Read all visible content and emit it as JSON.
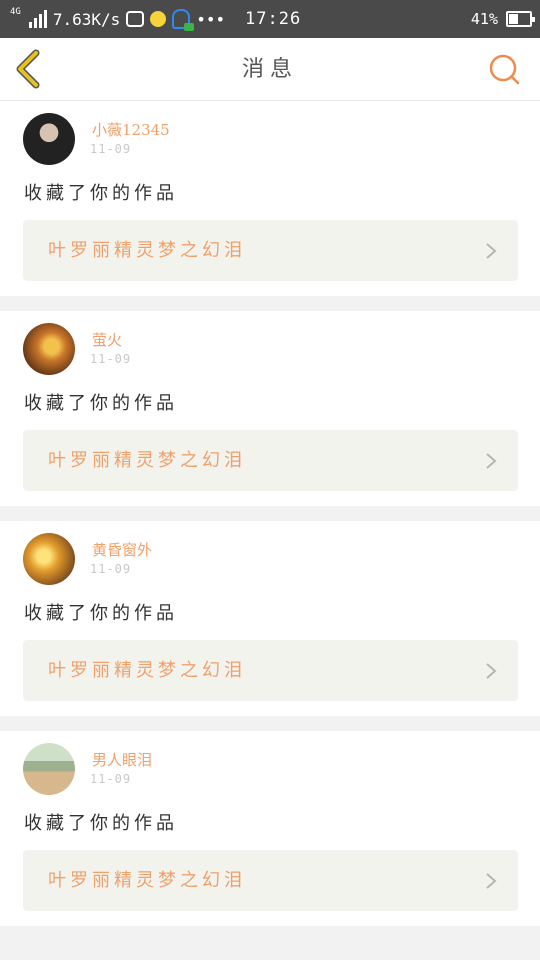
{
  "status_bar": {
    "network": "4G",
    "speed": "7.63K/s",
    "time": "17:26",
    "battery": "41%"
  },
  "header": {
    "title": "消息",
    "back_icon": "chevron-left-icon",
    "search_icon": "search-icon"
  },
  "colors": {
    "accent": "#f0a06a",
    "back_icon": "#e8c21c",
    "search_icon": "#f08a4b",
    "card_link_bg": "#f3f3ee"
  },
  "messages": [
    {
      "username": "小薇12345",
      "date": "11-09",
      "action": "收藏了你的作品",
      "work_title": "叶罗丽精灵梦之幻泪"
    },
    {
      "username": "萤火",
      "date": "11-09",
      "action": "收藏了你的作品",
      "work_title": "叶罗丽精灵梦之幻泪"
    },
    {
      "username": "黄昏窗外",
      "date": "11-09",
      "action": "收藏了你的作品",
      "work_title": "叶罗丽精灵梦之幻泪"
    },
    {
      "username": "男人眼泪",
      "date": "11-09",
      "action": "收藏了你的作品",
      "work_title": "叶罗丽精灵梦之幻泪"
    }
  ]
}
